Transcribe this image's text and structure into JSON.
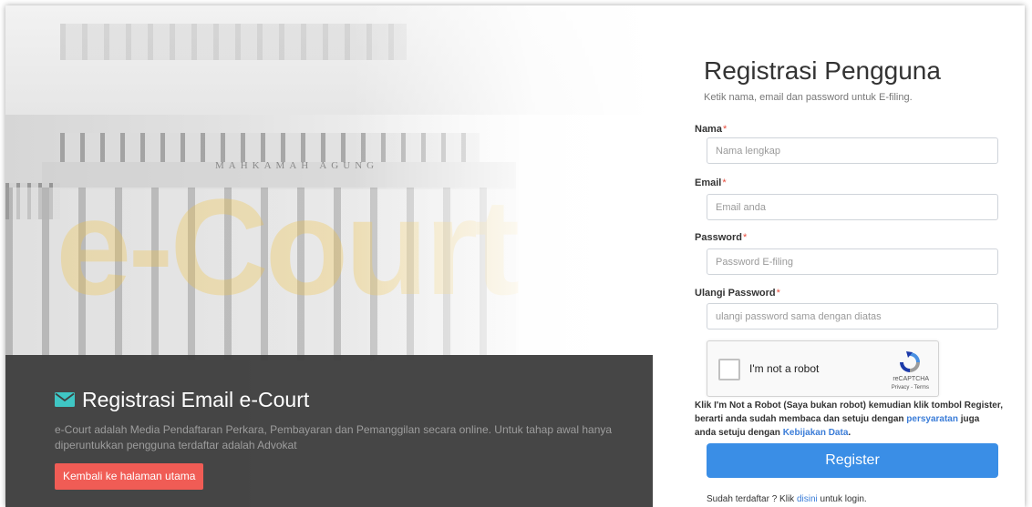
{
  "hero": {
    "building_text": "MAHKAMAH AGUNG",
    "watermark": "e-Court",
    "panel_title": "Registrasi Email e-Court",
    "panel_description": "e-Court adalah Media Pendaftaran Perkara, Pembayaran dan Pemanggilan secara online. Untuk tahap awal hanya diperuntukkan pengguna terdaftar adalah Advokat",
    "back_button": "Kembali ke halaman utama",
    "icon": "envelope-icon"
  },
  "form": {
    "title": "Registrasi Pengguna",
    "subtitle": "Ketik nama, email dan password untuk E-filing.",
    "fields": [
      {
        "label": "Nama",
        "required_mark": "*",
        "placeholder": "Nama lengkap",
        "value": ""
      },
      {
        "label": "Email",
        "required_mark": "*",
        "placeholder": "Email anda",
        "value": ""
      },
      {
        "label": "Password",
        "required_mark": "*",
        "placeholder": "Password E-filing",
        "value": ""
      },
      {
        "label": "Ulangi Password",
        "required_mark": "*",
        "placeholder": "ulangi password sama dengan diatas",
        "value": ""
      }
    ],
    "captcha": {
      "label": "I'm not a robot",
      "brand": "reCAPTCHA",
      "terms": "Privacy - Terms",
      "icon": "recaptcha-icon"
    },
    "notice": {
      "text_before": "Klik I'm Not a Robot (Saya bukan robot) kemudian klik tombol Register, berarti anda sudah membaca dan setuju dengan ",
      "link1": "persyaratan",
      "text_middle": " juga anda setuju dengan ",
      "link2": "Kebijakan Data",
      "text_after": "."
    },
    "register_button": "Register",
    "login": {
      "text_before": "Sudah terdaftar ? Klik ",
      "link": "disini",
      "text_after": " untuk login."
    }
  },
  "colors": {
    "panel_bg": "#404040",
    "back_button": "#f05c55",
    "register_button": "#3a8ee6",
    "link": "#3b7dd8",
    "required": "#e74c3c",
    "icon_teal": "#3fc6c4"
  }
}
